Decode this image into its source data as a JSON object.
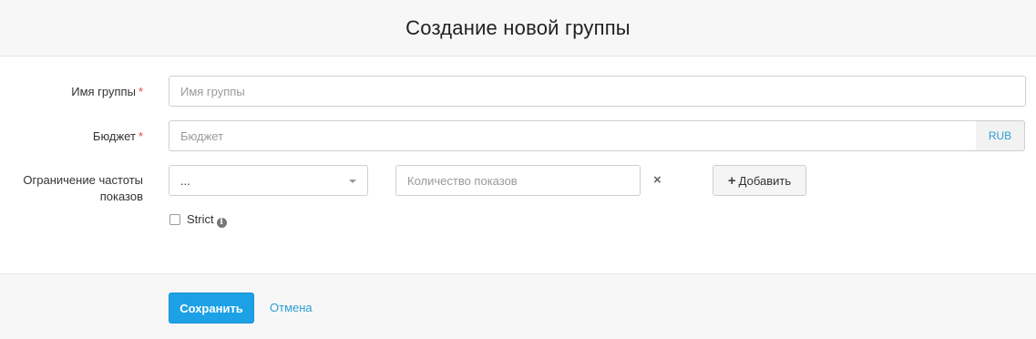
{
  "header": {
    "title": "Создание новой группы"
  },
  "form": {
    "group_name": {
      "label": "Имя группы",
      "required_mark": "*",
      "placeholder": "Имя группы",
      "value": ""
    },
    "budget": {
      "label": "Бюджет",
      "required_mark": "*",
      "placeholder": "Бюджет",
      "value": "",
      "currency": "RUB"
    },
    "frequency": {
      "label_line1": "Ограничение частоты",
      "label_line2": "показов",
      "period_select": "...",
      "impressions_placeholder": "Количество показов",
      "remove_icon": "×",
      "add_plus": "+",
      "add_label": "Добавить"
    },
    "strict": {
      "label": "Strict",
      "checked": false,
      "info_icon": "i"
    }
  },
  "footer": {
    "save_label": "Сохранить",
    "cancel_label": "Отмена"
  },
  "colors": {
    "primary": "#1da1e6",
    "link": "#2d9fd6",
    "required": "#e8463d"
  }
}
